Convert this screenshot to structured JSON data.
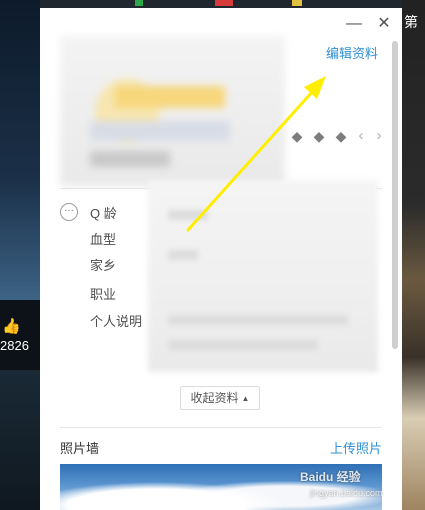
{
  "background": {
    "like_count": "2826",
    "right_edge_char": "第",
    "like_icon": "thumbs-up-icon"
  },
  "window": {
    "minimize_glyph": "—",
    "close_glyph": "✕",
    "edit_profile": "编辑资料",
    "badge_icons": [
      "diamond-icon",
      "diamond-icon",
      "diamond-icon"
    ],
    "prev_glyph": "‹",
    "next_glyph": "›",
    "more_glyph": "···",
    "fields": [
      "Q 龄",
      "血型",
      "家乡",
      "职业",
      "个人说明"
    ],
    "collapse_label": "收起资料",
    "collapse_glyph": "▲",
    "photo_wall_title": "照片墙",
    "upload_photo": "上传照片"
  },
  "watermark": {
    "text": "Baidu 经验",
    "sub": "jingyan.baidu.com"
  },
  "colors": {
    "link": "#2f8fd3",
    "annotation_arrow": "#ffee00"
  }
}
